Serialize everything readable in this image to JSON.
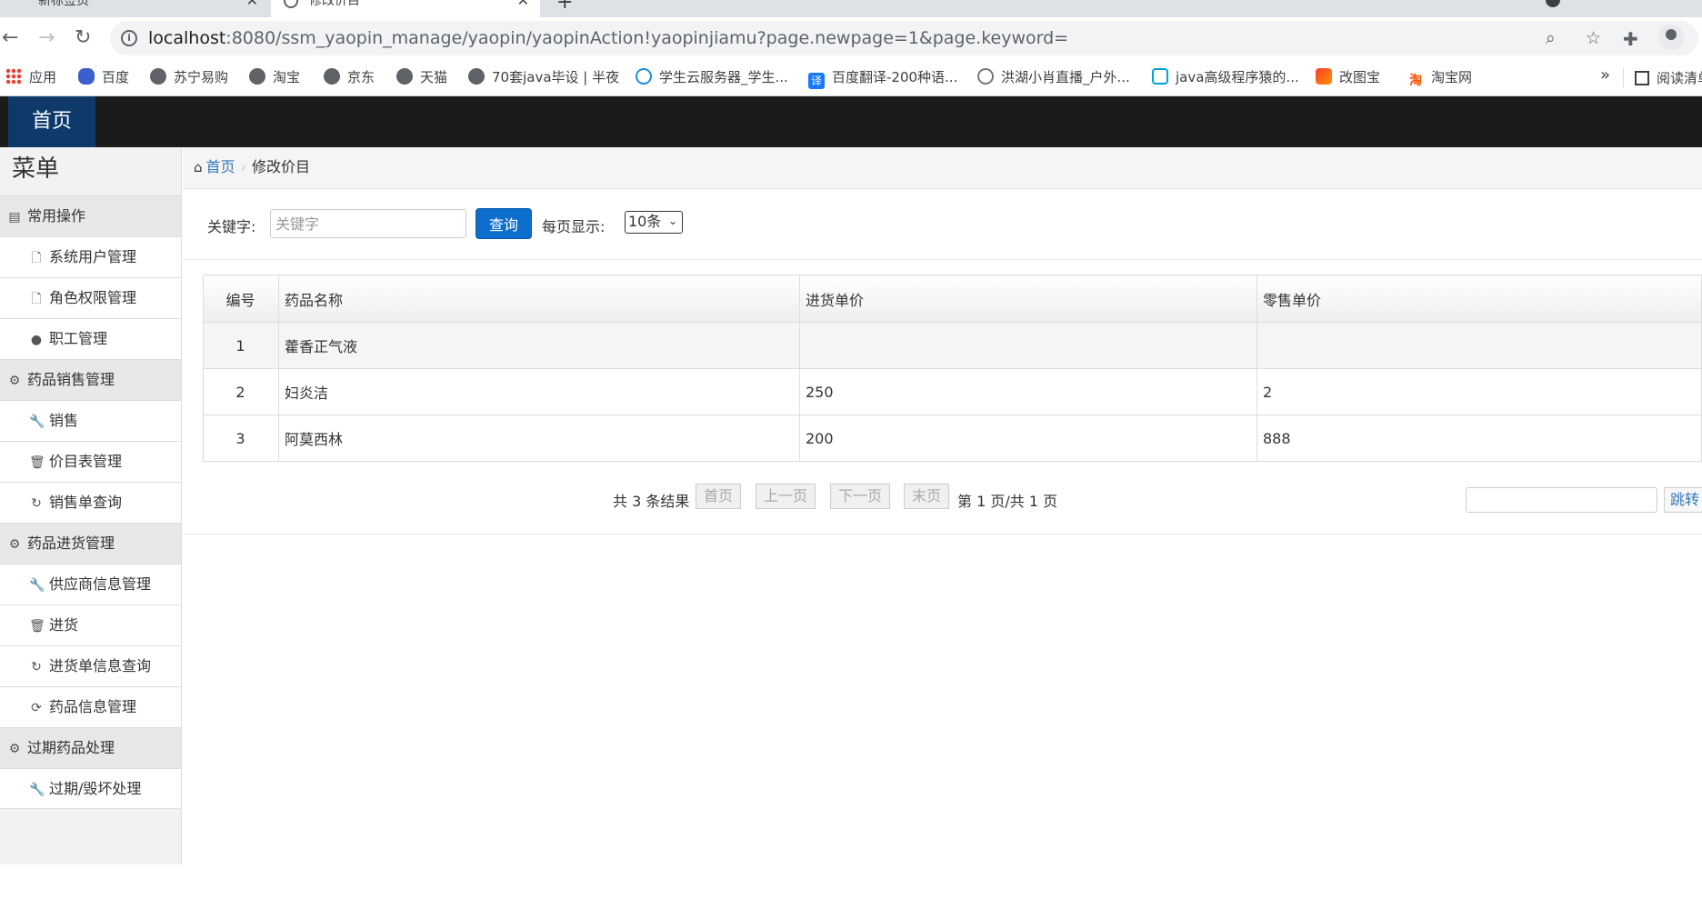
{
  "browser": {
    "tabs": [
      {
        "title": "新标签页"
      },
      {
        "title": "修改价目"
      }
    ],
    "url_host": "localhost",
    "url_rest": ":8080/ssm_yaopin_manage/yaopin/yaopinAction!yaopinjiamu?page.newpage=1&page.keyword=",
    "bookmarks": [
      {
        "label": "应用",
        "icon": "apps-grid-icon"
      },
      {
        "label": "百度",
        "icon": "baidu-paw-icon"
      },
      {
        "label": "苏宁易购",
        "icon": "globe-icon"
      },
      {
        "label": "淘宝",
        "icon": "globe-icon"
      },
      {
        "label": "京东",
        "icon": "globe-icon"
      },
      {
        "label": "天猫",
        "icon": "globe-icon"
      },
      {
        "label": "70套java毕设 | 半夜",
        "icon": "globe-icon"
      },
      {
        "label": "学生云服务器_学生...",
        "icon": "cloud-icon"
      },
      {
        "label": "百度翻译-200种语...",
        "icon": "translate-icon"
      },
      {
        "label": "洪湖小肖直播_户外...",
        "icon": "stream-icon"
      },
      {
        "label": "java高级程序猿的...",
        "icon": "bilibili-icon"
      },
      {
        "label": "改图宝",
        "icon": "gaitubao-icon"
      },
      {
        "label": "淘宝网",
        "icon": "taobao-icon"
      }
    ],
    "more": "»",
    "reading_list": "阅读清单"
  },
  "app": {
    "home_tab": "首页",
    "menu_title": "菜单",
    "menu": [
      {
        "label": "常用操作",
        "type": "group",
        "icon": "list-icon"
      },
      {
        "label": "系统用户管理",
        "type": "item",
        "icon": "file-icon"
      },
      {
        "label": "角色权限管理",
        "type": "item",
        "icon": "file-icon"
      },
      {
        "label": "职工管理",
        "type": "item",
        "icon": "comment-icon"
      },
      {
        "label": "药品销售管理",
        "type": "group",
        "icon": "gear-icon"
      },
      {
        "label": "销售",
        "type": "item",
        "icon": "wrench-icon"
      },
      {
        "label": "价目表管理",
        "type": "item",
        "icon": "trash-icon"
      },
      {
        "label": "销售单查询",
        "type": "item",
        "icon": "refresh-icon"
      },
      {
        "label": "药品进货管理",
        "type": "group",
        "icon": "gear-icon"
      },
      {
        "label": "供应商信息管理",
        "type": "item",
        "icon": "wrench-icon"
      },
      {
        "label": "进货",
        "type": "item",
        "icon": "trash-icon"
      },
      {
        "label": "进货单信息查询",
        "type": "item",
        "icon": "refresh-icon"
      },
      {
        "label": "药品信息管理",
        "type": "item",
        "icon": "sync-icon"
      },
      {
        "label": "过期药品处理",
        "type": "group",
        "icon": "gear-icon"
      },
      {
        "label": "过期/毁坏处理",
        "type": "item",
        "icon": "wrench-icon"
      }
    ],
    "breadcrumb": {
      "home": "首页",
      "current": "修改价目"
    },
    "search": {
      "keyword_label": "关键字:",
      "keyword_placeholder": "关键字",
      "keyword_value": "",
      "query_button": "查询",
      "per_page_label": "每页显示:",
      "per_page_value": "10条"
    },
    "table": {
      "headers": [
        "编号",
        "药品名称",
        "进货单价",
        "零售单价"
      ],
      "rows": [
        [
          "1",
          "藿香正气液",
          "",
          ""
        ],
        [
          "2",
          "妇炎洁",
          "250",
          "2"
        ],
        [
          "3",
          "阿莫西林",
          "200",
          "888"
        ]
      ]
    },
    "pager": {
      "total": "共 3 条结果",
      "first": "首页",
      "prev": "上一页",
      "next": "下一页",
      "last": "末页",
      "status": "第 1 页/共 1 页",
      "go": "跳转"
    }
  }
}
